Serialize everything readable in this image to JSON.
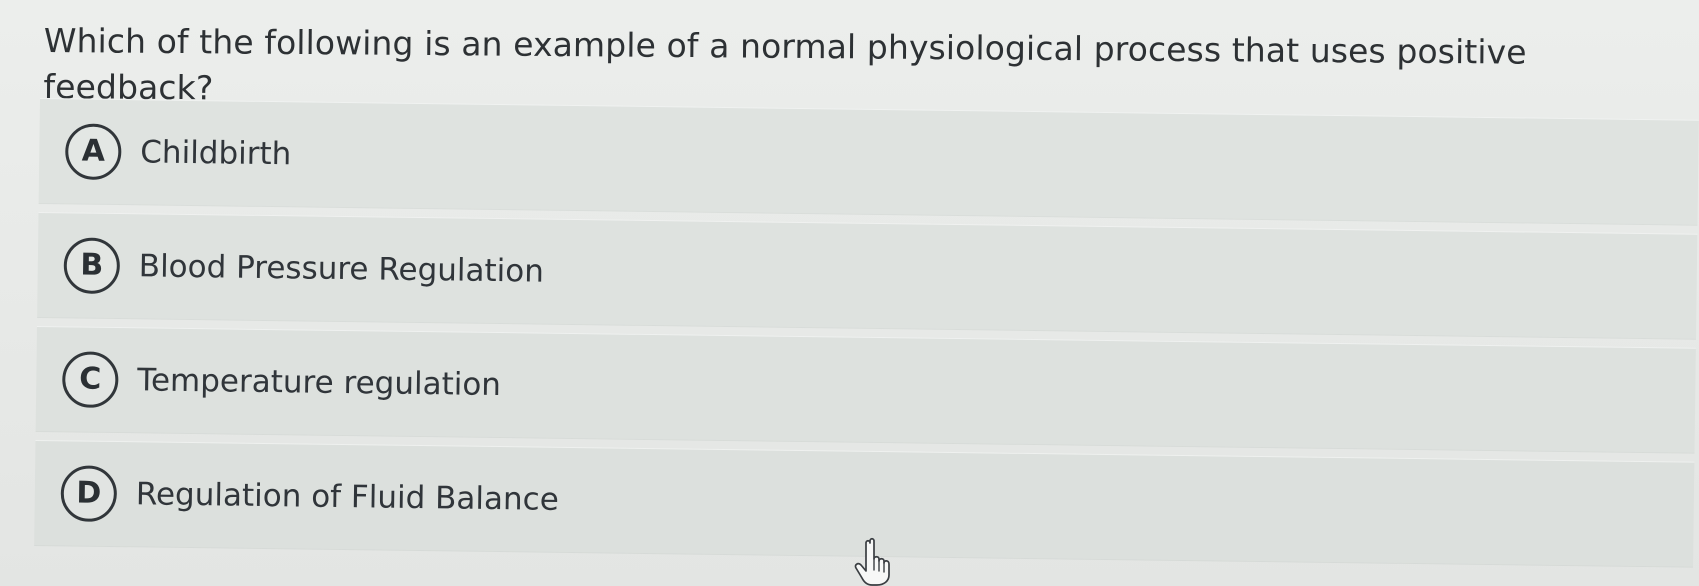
{
  "question": {
    "text": "Which of the following is an example of a normal physiological process that uses positive feedback?"
  },
  "options": [
    {
      "letter": "A",
      "text": "Childbirth"
    },
    {
      "letter": "B",
      "text": "Blood Pressure Regulation"
    },
    {
      "letter": "C",
      "text": "Temperature regulation"
    },
    {
      "letter": "D",
      "text": "Regulation of Fluid Balance"
    }
  ],
  "cursor": {
    "icon": "hand-pointer-icon"
  },
  "colors": {
    "background": "#e9ebe9",
    "option_background": "#dfe3e0",
    "text": "#2d3134"
  }
}
